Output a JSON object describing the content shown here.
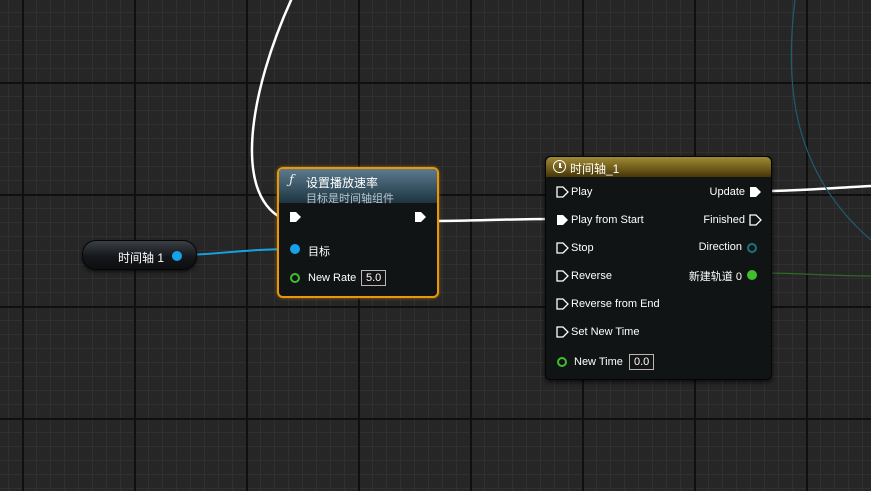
{
  "var_node": {
    "label": "时间轴 1"
  },
  "func_node": {
    "title": "设置播放速率",
    "subtitle": "目标是时间轴组件",
    "target_label": "目标",
    "new_rate_label": "New Rate",
    "new_rate_value": "5.0"
  },
  "timeline_node": {
    "title": "时间轴_1",
    "inputs": [
      {
        "label": "Play"
      },
      {
        "label": "Play from Start"
      },
      {
        "label": "Stop"
      },
      {
        "label": "Reverse"
      },
      {
        "label": "Reverse from End"
      },
      {
        "label": "Set New Time"
      }
    ],
    "new_time_label": "New Time",
    "new_time_value": "0.0",
    "outputs": {
      "update": "Update",
      "finished": "Finished",
      "direction": "Direction",
      "new_track": "新建轨道 0"
    }
  },
  "colors": {
    "exec_wire": "#ffffff",
    "object_pin": "#15a3e8",
    "float_pin": "#3fbf2e",
    "enum_pin": "#1d6f6f",
    "selection_outline": "#e99608"
  },
  "icons": [
    "function-icon",
    "clock-icon",
    "exec-pin-icon",
    "data-pin-icon"
  ]
}
